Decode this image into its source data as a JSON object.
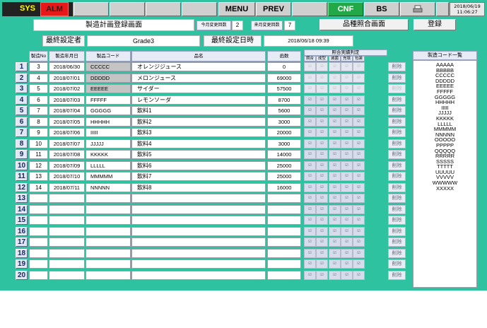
{
  "toolbar": {
    "sys": "SYS",
    "alm": "ALM",
    "menu": "MENU",
    "prev": "PREV",
    "cnf": "CNF",
    "bs": "BS",
    "clock_date": "2018/06/19",
    "clock_time": "11:06:27"
  },
  "header": {
    "title": "製造計画登録画面",
    "this_month_label": "今月変更回数",
    "this_month_value": "2",
    "next_month_label": "来月変更回数",
    "next_month_value": "7",
    "compare_screen": "品種照合画面",
    "register": "登録",
    "setter_label": "最終設定者",
    "setter_value": "Grade3",
    "datetime_label": "最終設定日時",
    "datetime_value": "2018/06/18 09:39"
  },
  "table": {
    "col_no": "製造No",
    "col_date": "製造年月日",
    "col_code": "製品コード",
    "col_name": "品名",
    "col_qty": "函数",
    "check_group": "照合実績判定",
    "check_cols": [
      "調合",
      "成型",
      "滅菌",
      "充填",
      "包装"
    ],
    "delete_label": "削除",
    "rows": [
      {
        "row": "1",
        "no": "3",
        "date": "2018/06/30",
        "code": "CCCCC",
        "name": "オレンジジュース",
        "qty": "0"
      },
      {
        "row": "2",
        "no": "4",
        "date": "2018/07/01",
        "code": "DDDDD",
        "name": "メロンジュース",
        "qty": "69000"
      },
      {
        "row": "3",
        "no": "5",
        "date": "2018/07/02",
        "code": "EEEEE",
        "name": "サイダー",
        "qty": "57500"
      },
      {
        "row": "4",
        "no": "6",
        "date": "2018/07/03",
        "code": "FFFFF",
        "name": "レモンソーダ",
        "qty": "8700"
      },
      {
        "row": "5",
        "no": "7",
        "date": "2018/07/04",
        "code": "GGGGG",
        "name": "飲料1",
        "qty": "5600"
      },
      {
        "row": "6",
        "no": "8",
        "date": "2018/07/05",
        "code": "HHHHH",
        "name": "飲料2",
        "qty": "3000"
      },
      {
        "row": "7",
        "no": "9",
        "date": "2018/07/06",
        "code": "IIIII",
        "name": "飲料3",
        "qty": "20000"
      },
      {
        "row": "8",
        "no": "10",
        "date": "2018/07/07",
        "code": "JJJJJ",
        "name": "飲料4",
        "qty": "3000"
      },
      {
        "row": "9",
        "no": "11",
        "date": "2018/07/08",
        "code": "KKKKK",
        "name": "飲料5",
        "qty": "14000"
      },
      {
        "row": "10",
        "no": "12",
        "date": "2018/07/09",
        "code": "LLLLL",
        "name": "飲料6",
        "qty": "25000"
      },
      {
        "row": "11",
        "no": "13",
        "date": "2018/07/10",
        "code": "MMMMM",
        "name": "飲料7",
        "qty": "25000"
      },
      {
        "row": "12",
        "no": "14",
        "date": "2018/07/11",
        "code": "NNNNN",
        "name": "飲料8",
        "qty": "16000"
      },
      {
        "row": "13",
        "no": "",
        "date": "",
        "code": "",
        "name": "",
        "qty": ""
      },
      {
        "row": "14",
        "no": "",
        "date": "",
        "code": "",
        "name": "",
        "qty": ""
      },
      {
        "row": "15",
        "no": "",
        "date": "",
        "code": "",
        "name": "",
        "qty": ""
      },
      {
        "row": "16",
        "no": "",
        "date": "",
        "code": "",
        "name": "",
        "qty": ""
      },
      {
        "row": "17",
        "no": "",
        "date": "",
        "code": "",
        "name": "",
        "qty": ""
      },
      {
        "row": "18",
        "no": "",
        "date": "",
        "code": "",
        "name": "",
        "qty": ""
      },
      {
        "row": "19",
        "no": "",
        "date": "",
        "code": "",
        "name": "",
        "qty": ""
      },
      {
        "row": "20",
        "no": "",
        "date": "",
        "code": "",
        "name": "",
        "qty": ""
      }
    ]
  },
  "code_list": {
    "title": "製造コード一覧",
    "items": [
      "AAAAA",
      "BBBBB",
      "CCCCC",
      "DDDDD",
      "EEEEE",
      "FFFFF",
      "GGGGG",
      "HHHHH",
      "IIIII",
      "JJJJJ",
      "KKKKK",
      "LLLLL",
      "MMMMM",
      "NNNNN",
      "OOOOO",
      "PPPPP",
      "QQQQQ",
      "RRRRR",
      "SSSSS",
      "TTTTT",
      "UUUUU",
      "VVVVV",
      "WWWWW",
      "XXXXX"
    ]
  }
}
